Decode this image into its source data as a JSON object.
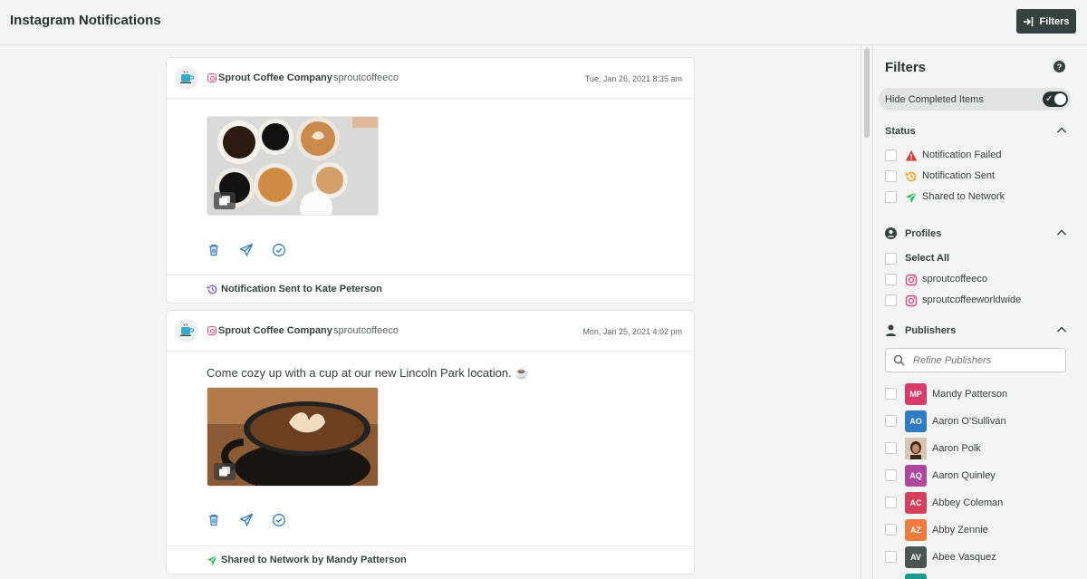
{
  "header": {
    "title": "Instagram Notifications",
    "filters_button": "Filters"
  },
  "posts": [
    {
      "profile": "Sprout Coffee Company",
      "handle": "sproutcoffeeco",
      "timestamp": "Tue, Jan 26, 2021 8:35 am",
      "text": "",
      "footer": "Notification Sent to Kate Peterson",
      "footer_icon": "history-icon"
    },
    {
      "profile": "Sprout Coffee Company",
      "handle": "sproutcoffeeco",
      "timestamp": "Mon, Jan 25, 2021 4:02 pm",
      "text": "Come cozy up with a cup at our new Lincoln Park location. ☕",
      "footer": "Shared to Network by Mandy Patterson",
      "footer_icon": "send-icon"
    }
  ],
  "filters": {
    "title": "Filters",
    "hide_completed": {
      "label": "Hide Completed Items",
      "enabled": true
    },
    "status": {
      "title": "Status",
      "options": [
        {
          "label": "Notification Failed",
          "icon": "warning-icon",
          "color": "#d93a3a"
        },
        {
          "label": "Notification Sent",
          "icon": "history-icon",
          "color": "#f2a01d"
        },
        {
          "label": "Shared to Network",
          "icon": "send-icon",
          "color": "#3cba62"
        }
      ]
    },
    "profiles": {
      "title": "Profiles",
      "select_all": "Select All",
      "options": [
        {
          "label": "sproutcoffeeco",
          "icon": "instagram-icon"
        },
        {
          "label": "sproutcoffeeworldwide",
          "icon": "instagram-icon"
        }
      ]
    },
    "publishers": {
      "title": "Publishers",
      "search_placeholder": "Refine Publishers",
      "items": [
        {
          "initials": "MP",
          "name": "Mandy Patterson",
          "color": "#d93a6a"
        },
        {
          "initials": "AO",
          "name": "Aaron O'Sullivan",
          "color": "#2f7bc4"
        },
        {
          "initials": "",
          "name": "Aaron Polk",
          "color": "#5a4030"
        },
        {
          "initials": "AQ",
          "name": "Aaron Quinley",
          "color": "#b0479f"
        },
        {
          "initials": "AC",
          "name": "Abbey Coleman",
          "color": "#d6405c"
        },
        {
          "initials": "AZ",
          "name": "Abby Zennie",
          "color": "#f07b3f"
        },
        {
          "initials": "AV",
          "name": "Abee Vasquez",
          "color": "#4a5656"
        }
      ]
    }
  },
  "colors": {
    "accent": "#2f7bc4",
    "dark": "#364141"
  }
}
